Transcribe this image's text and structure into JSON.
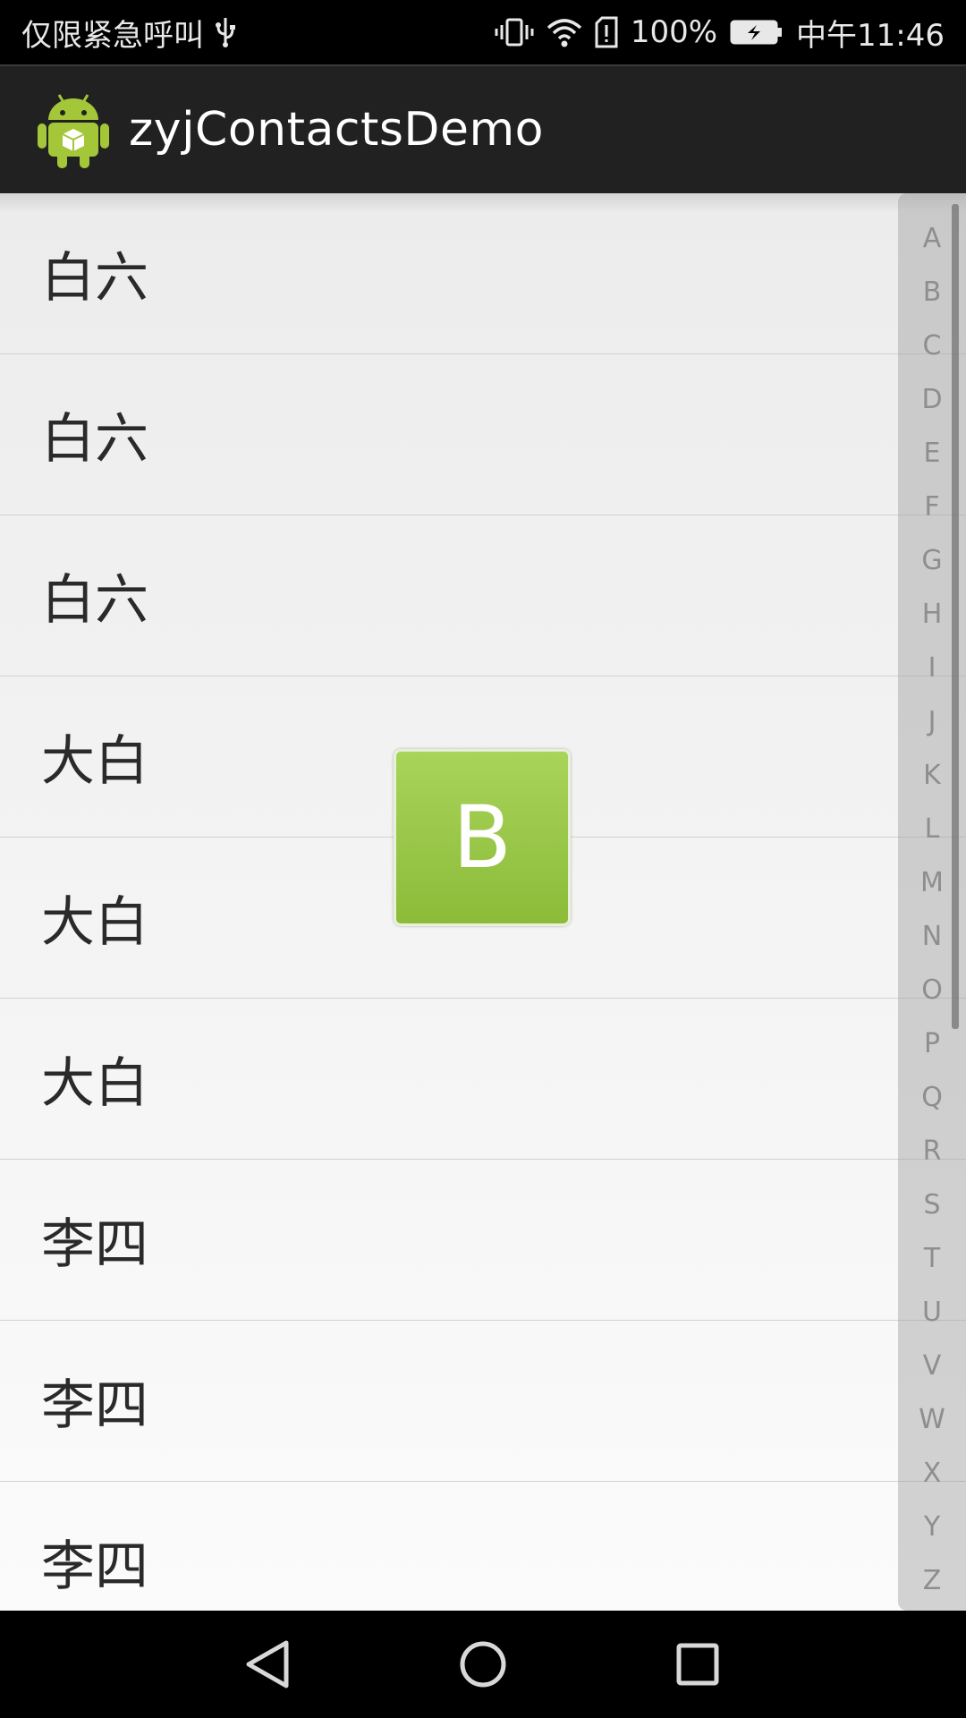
{
  "status_bar": {
    "carrier_text": "仅限紧急呼叫",
    "battery_percent": "100%",
    "time": "中午11:46",
    "icons": [
      "usb-icon",
      "vibrate-icon",
      "wifi-icon",
      "sim-alert-icon",
      "battery-charging-icon"
    ]
  },
  "app_bar": {
    "title": "zyjContactsDemo",
    "logo_icon": "android-robot-icon"
  },
  "contacts": [
    {
      "name": "白六"
    },
    {
      "name": "白六"
    },
    {
      "name": "白六"
    },
    {
      "name": "大白"
    },
    {
      "name": "大白"
    },
    {
      "name": "大白"
    },
    {
      "name": "李四"
    },
    {
      "name": "李四"
    },
    {
      "name": "李四"
    }
  ],
  "side_index": {
    "letters": [
      "A",
      "B",
      "C",
      "D",
      "E",
      "F",
      "G",
      "H",
      "I",
      "J",
      "K",
      "L",
      "M",
      "N",
      "O",
      "P",
      "Q",
      "R",
      "S",
      "T",
      "U",
      "V",
      "W",
      "X",
      "Y",
      "Z"
    ]
  },
  "overlay": {
    "letter": "B",
    "color": "#95c343"
  },
  "nav_bar": {
    "icons": [
      "back-icon",
      "home-icon",
      "recents-icon"
    ]
  }
}
